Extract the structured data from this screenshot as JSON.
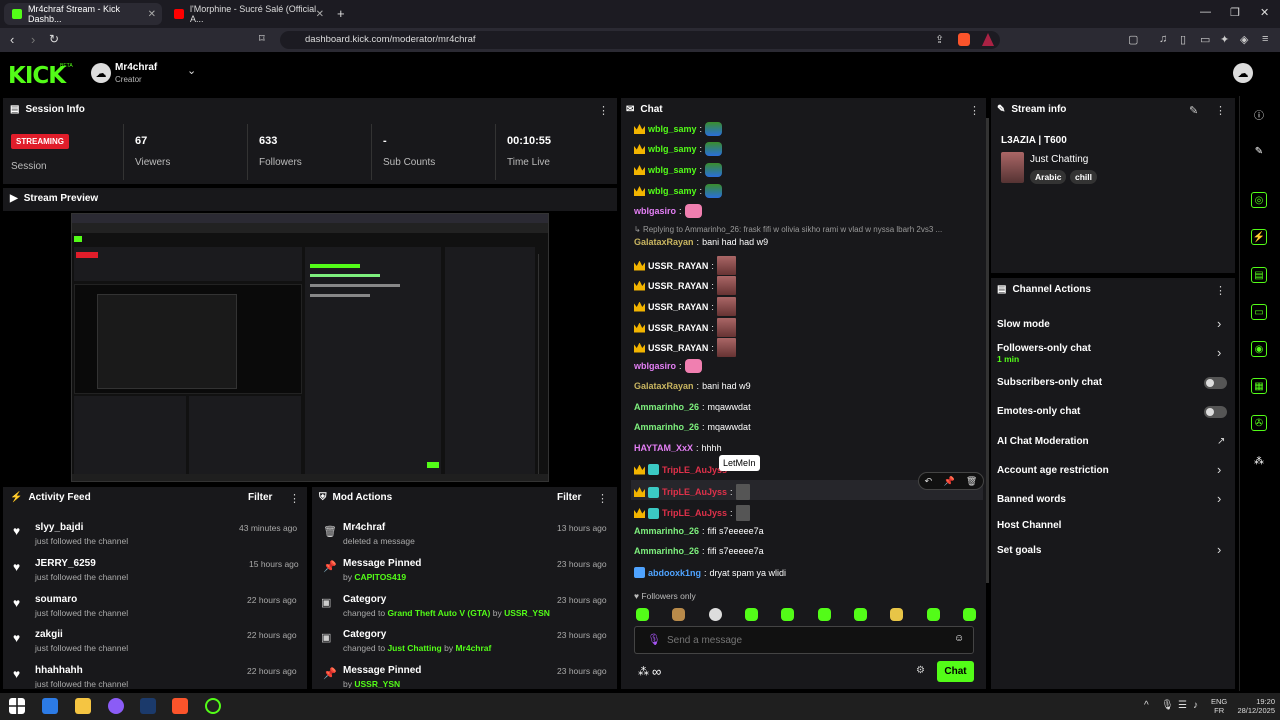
{
  "browser": {
    "tabs": [
      {
        "title": "Mr4chraf Stream - Kick Dashb..."
      },
      {
        "title": "l'Morphine - Sucré Salé (Official A..."
      }
    ],
    "url": "dashboard.kick.com/moderator/mr4chraf"
  },
  "header": {
    "logo": "KICK",
    "logo_beta": "BETA",
    "user_name": "Mr4chraf",
    "user_role": "Creator"
  },
  "session": {
    "title": "Session Info",
    "status": "STREAMING",
    "status_label": "Session",
    "stats": [
      {
        "value": "67",
        "label": "Viewers"
      },
      {
        "value": "633",
        "label": "Followers"
      },
      {
        "value": "-",
        "label": "Sub Counts"
      },
      {
        "value": "00:10:55",
        "label": "Time Live"
      }
    ]
  },
  "preview": {
    "title": "Stream Preview"
  },
  "activity": {
    "title": "Activity Feed",
    "filter": "Filter",
    "items": [
      {
        "name": "slyy_bajdi",
        "sub": "just followed the channel",
        "time": "43 minutes ago"
      },
      {
        "name": "JERRY_6259",
        "sub": "just followed the channel",
        "time": "15 hours ago"
      },
      {
        "name": "soumaro",
        "sub": "just followed the channel",
        "time": "22 hours ago"
      },
      {
        "name": "zakgii",
        "sub": "just followed the channel",
        "time": "22 hours ago"
      },
      {
        "name": "hhahhahh",
        "sub": "just followed the channel",
        "time": "22 hours ago"
      }
    ]
  },
  "mod": {
    "title": "Mod Actions",
    "filter": "Filter",
    "items": [
      {
        "title": "Mr4chraf",
        "pre": "deleted a message",
        "link1": "",
        "mid": "",
        "link2": "",
        "time": "13 hours ago"
      },
      {
        "title": "Message Pinned",
        "pre": "by ",
        "link1": "CAPITOS419",
        "mid": "",
        "link2": "",
        "time": "23 hours ago"
      },
      {
        "title": "Category",
        "pre": "changed to ",
        "link1": "Grand Theft Auto V (GTA)",
        "mid": " by ",
        "link2": "USSR_YSN",
        "time": "23 hours ago"
      },
      {
        "title": "Category",
        "pre": "changed to ",
        "link1": "Just Chatting",
        "mid": " by ",
        "link2": "Mr4chraf",
        "time": "23 hours ago"
      },
      {
        "title": "Message Pinned",
        "pre": "by ",
        "link1": "USSR_YSN",
        "mid": "",
        "link2": "",
        "time": "23 hours ago"
      }
    ]
  },
  "chat": {
    "title": "Chat",
    "reply_text": "Replying to Ammarinho_26: frask fifi w olivia sikho rami w vlad w nyssa lbarh 2vs3 ...",
    "tooltip": "LetMeIn",
    "followers_only": "Followers only",
    "placeholder": "Send a message",
    "send": "Chat",
    "messages": [
      {
        "user": "wblg_samy",
        "text": "",
        "color": "#53fc18"
      },
      {
        "user": "wblg_samy",
        "text": "",
        "color": "#53fc18"
      },
      {
        "user": "wblg_samy",
        "text": "",
        "color": "#53fc18"
      },
      {
        "user": "wblg_samy",
        "text": "",
        "color": "#53fc18"
      },
      {
        "user": "wblgasiro",
        "text": "",
        "color": "#e47ff5"
      },
      {
        "user": "GalataxRayan",
        "text": "bani had had w9",
        "color": "#c9b560"
      },
      {
        "user": "USSR_RAYAN",
        "text": "",
        "color": "#ffffff"
      },
      {
        "user": "USSR_RAYAN",
        "text": "",
        "color": "#ffffff"
      },
      {
        "user": "USSR_RAYAN",
        "text": "",
        "color": "#ffffff"
      },
      {
        "user": "USSR_RAYAN",
        "text": "",
        "color": "#ffffff"
      },
      {
        "user": "USSR_RAYAN",
        "text": "",
        "color": "#ffffff"
      },
      {
        "user": "wblgasiro",
        "text": "",
        "color": "#e47ff5"
      },
      {
        "user": "GalataxRayan",
        "text": "bani had w9",
        "color": "#c9b560"
      },
      {
        "user": "Ammarinho_26",
        "text": "mqawwdat",
        "color": "#7ef07e"
      },
      {
        "user": "Ammarinho_26",
        "text": "mqawwdat",
        "color": "#7ef07e"
      },
      {
        "user": "HAYTAM_XxX",
        "text": "hhhh",
        "color": "#e47ff5"
      },
      {
        "user": "TripLE_AuJyss",
        "text": "",
        "color": "#e0314a"
      },
      {
        "user": "TripLE_AuJyss",
        "text": "",
        "color": "#e0314a"
      },
      {
        "user": "TripLE_AuJyss",
        "text": "",
        "color": "#e0314a"
      },
      {
        "user": "Ammarinho_26",
        "text": "fifi s7eeeee7a",
        "color": "#7ef07e"
      },
      {
        "user": "Ammarinho_26",
        "text": "fifi s7eeeee7a",
        "color": "#7ef07e"
      },
      {
        "user": "abdooxk1ng",
        "text": "dryat spam ya wlidi",
        "color": "#4fa3ff"
      }
    ]
  },
  "stream_info": {
    "title": "Stream info",
    "stream_title": "L3AZIA | T600",
    "category": "Just Chatting",
    "tags": [
      "Arabic",
      "chill"
    ]
  },
  "channel_actions": {
    "title": "Channel Actions",
    "items": [
      {
        "label": "Slow mode",
        "sub": ""
      },
      {
        "label": "Followers-only chat",
        "sub": "1 min"
      },
      {
        "label": "Subscribers-only chat",
        "sub": ""
      },
      {
        "label": "Emotes-only chat",
        "sub": ""
      },
      {
        "label": "AI Chat Moderation",
        "sub": ""
      },
      {
        "label": "Account age restriction",
        "sub": ""
      },
      {
        "label": "Banned words",
        "sub": ""
      },
      {
        "label": "Host Channel",
        "sub": ""
      },
      {
        "label": "Set goals",
        "sub": ""
      }
    ]
  },
  "taskbar": {
    "lang": "ENG",
    "lang2": "FR",
    "time": "19:20",
    "date": "28/12/2025"
  }
}
